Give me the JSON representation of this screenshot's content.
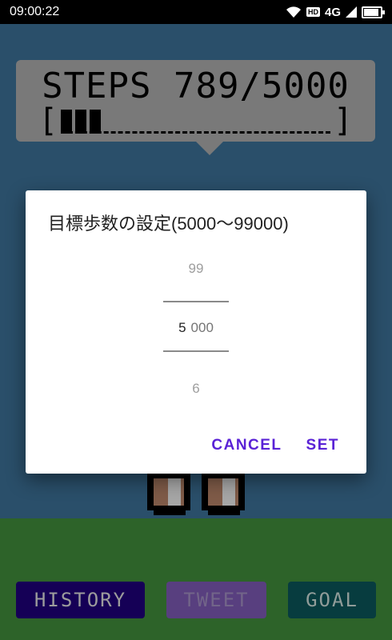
{
  "status_bar": {
    "time": "09:00:22",
    "hd_label": "HD",
    "network_label": "4G",
    "battery_level": 0.9
  },
  "game": {
    "steps_text": "STEPS 789/5000",
    "steps_current": 789,
    "steps_goal": 5000,
    "progress_left_bracket": "[",
    "progress_right_bracket": "]"
  },
  "buttons": {
    "history": "HISTORY",
    "tweet": "TWEET",
    "goal": "GOAL"
  },
  "dialog": {
    "title": "目標歩数の設定(5000〜99000)",
    "picker": {
      "prev_value": "99",
      "current_value": "5",
      "current_suffix": "000",
      "next_value": "6"
    },
    "cancel_label": "CANCEL",
    "set_label": "SET"
  },
  "colors": {
    "sky": "#3b6e94",
    "ground": "#3f8a3a",
    "accent": "#5a22d6",
    "history_button": "#1e0078",
    "tweet_button": "#7a58b0",
    "goal_button": "#0b5458"
  },
  "icons": [
    "wifi-icon",
    "hd-icon",
    "signal-icon",
    "battery-icon"
  ]
}
